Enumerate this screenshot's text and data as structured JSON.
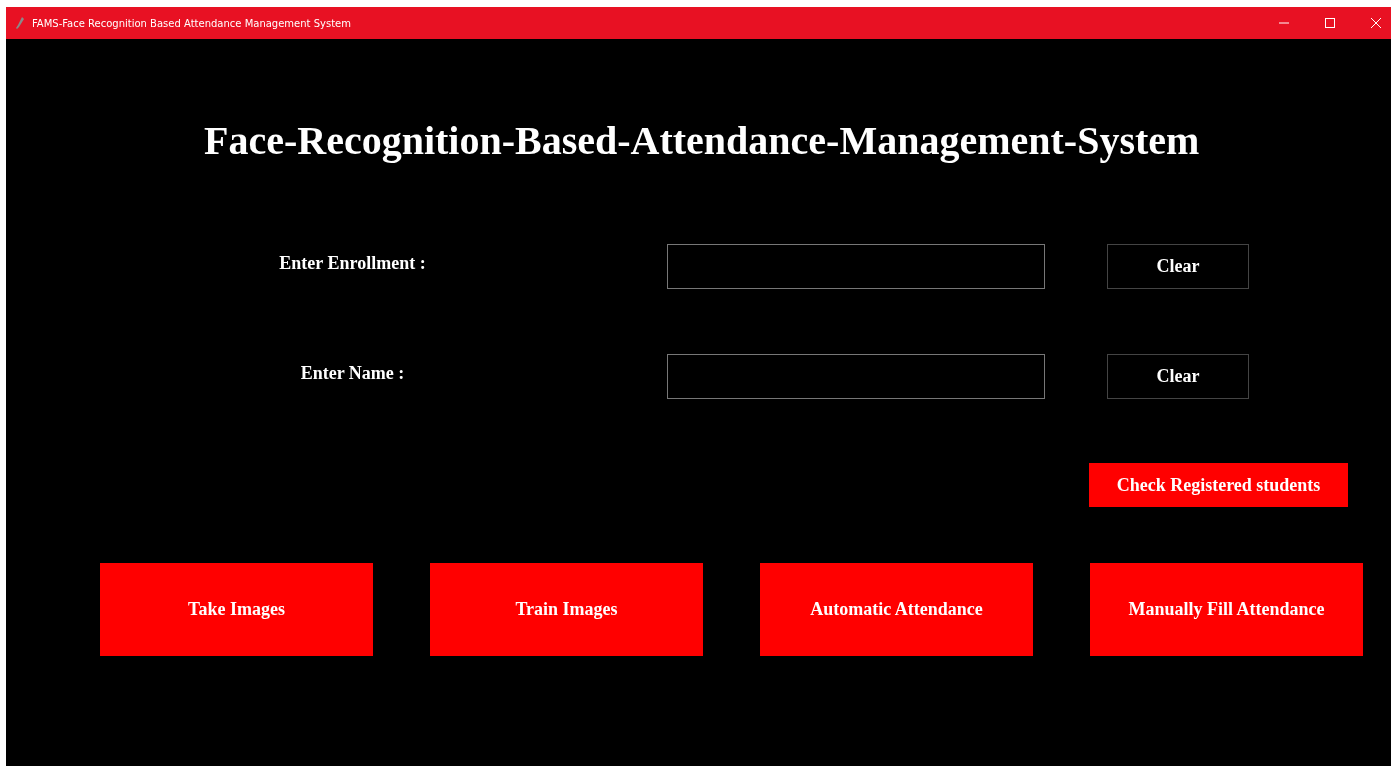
{
  "window": {
    "title": "FAMS-Face Recognition Based Attendance Management System"
  },
  "heading": "Face-Recognition-Based-Attendance-Management-System",
  "fields": [
    {
      "label": "Enter Enrollment :",
      "button": "Clear"
    },
    {
      "label": "Enter Name :",
      "button": "Clear"
    }
  ],
  "check_button": "Check Registered students",
  "actions": [
    "Take Images",
    "Train Images",
    "Automatic Attendance",
    "Manually Fill Attendance"
  ]
}
